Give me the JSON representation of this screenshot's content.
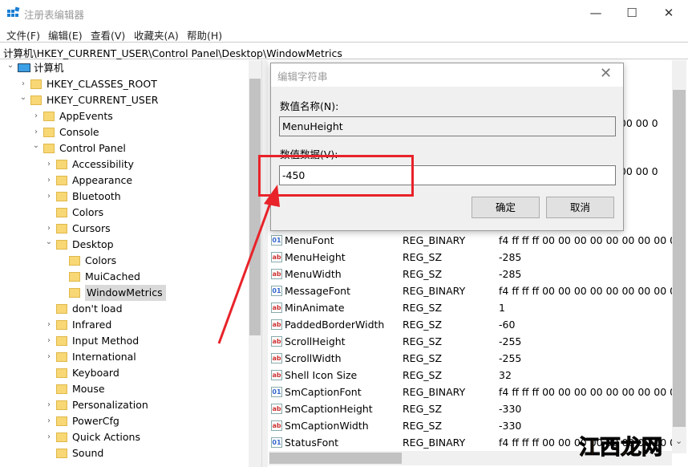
{
  "window": {
    "title": "注册表编辑器",
    "minimize": "—",
    "maximize": "☐",
    "close": "✕"
  },
  "menu": [
    "文件(F)",
    "编辑(E)",
    "查看(V)",
    "收藏夹(A)",
    "帮助(H)"
  ],
  "address": "计算机\\HKEY_CURRENT_USER\\Control Panel\\Desktop\\WindowMetrics",
  "tree": [
    {
      "label": "计算机",
      "depth": 0,
      "exp": "open",
      "icon": "computer"
    },
    {
      "label": "HKEY_CLASSES_ROOT",
      "depth": 1,
      "exp": "closed"
    },
    {
      "label": "HKEY_CURRENT_USER",
      "depth": 1,
      "exp": "open"
    },
    {
      "label": "AppEvents",
      "depth": 2,
      "exp": "closed"
    },
    {
      "label": "Console",
      "depth": 2,
      "exp": "closed"
    },
    {
      "label": "Control Panel",
      "depth": 2,
      "exp": "open"
    },
    {
      "label": "Accessibility",
      "depth": 3,
      "exp": "closed"
    },
    {
      "label": "Appearance",
      "depth": 3,
      "exp": "closed"
    },
    {
      "label": "Bluetooth",
      "depth": 3,
      "exp": "closed"
    },
    {
      "label": "Colors",
      "depth": 3,
      "exp": "none"
    },
    {
      "label": "Cursors",
      "depth": 3,
      "exp": "closed"
    },
    {
      "label": "Desktop",
      "depth": 3,
      "exp": "open"
    },
    {
      "label": "Colors",
      "depth": 4,
      "exp": "none"
    },
    {
      "label": "MuiCached",
      "depth": 4,
      "exp": "none"
    },
    {
      "label": "WindowMetrics",
      "depth": 4,
      "exp": "none",
      "selected": true
    },
    {
      "label": "don't load",
      "depth": 3,
      "exp": "none"
    },
    {
      "label": "Infrared",
      "depth": 3,
      "exp": "closed"
    },
    {
      "label": "Input Method",
      "depth": 3,
      "exp": "closed"
    },
    {
      "label": "International",
      "depth": 3,
      "exp": "closed"
    },
    {
      "label": "Keyboard",
      "depth": 3,
      "exp": "none"
    },
    {
      "label": "Mouse",
      "depth": 3,
      "exp": "none"
    },
    {
      "label": "Personalization",
      "depth": 3,
      "exp": "closed"
    },
    {
      "label": "PowerCfg",
      "depth": 3,
      "exp": "closed"
    },
    {
      "label": "Quick Actions",
      "depth": 3,
      "exp": "closed"
    },
    {
      "label": "Sound",
      "depth": 3,
      "exp": "none"
    }
  ],
  "values_partial": [
    "00 00 00 0",
    "00 00 00 0"
  ],
  "values": [
    {
      "name": "MenuFont",
      "type": "REG_BINARY",
      "data": "f4 ff ff ff 00 00 00 00 00 00 00 00 00 00 0"
    },
    {
      "name": "MenuHeight",
      "type": "REG_SZ",
      "data": "-285"
    },
    {
      "name": "MenuWidth",
      "type": "REG_SZ",
      "data": "-285"
    },
    {
      "name": "MessageFont",
      "type": "REG_BINARY",
      "data": "f4 ff ff ff 00 00 00 00 00 00 00 00 00 00 0"
    },
    {
      "name": "MinAnimate",
      "type": "REG_SZ",
      "data": "1"
    },
    {
      "name": "PaddedBorderWidth",
      "type": "REG_SZ",
      "data": "-60"
    },
    {
      "name": "ScrollHeight",
      "type": "REG_SZ",
      "data": "-255"
    },
    {
      "name": "ScrollWidth",
      "type": "REG_SZ",
      "data": "-255"
    },
    {
      "name": "Shell Icon Size",
      "type": "REG_SZ",
      "data": "32"
    },
    {
      "name": "SmCaptionFont",
      "type": "REG_BINARY",
      "data": "f4 ff ff ff 00 00 00 00 00 00 00 00 00 00 0"
    },
    {
      "name": "SmCaptionHeight",
      "type": "REG_SZ",
      "data": "-330"
    },
    {
      "name": "SmCaptionWidth",
      "type": "REG_SZ",
      "data": "-330"
    },
    {
      "name": "StatusFont",
      "type": "REG_BINARY",
      "data": "f4 ff ff ff 00 00 00 00 00 00 00 00 00 00 0"
    }
  ],
  "dialog": {
    "title": "编辑字符串",
    "name_label": "数值名称(N):",
    "name_value": "MenuHeight",
    "data_label": "数值数据(V):",
    "data_value": "-450",
    "ok": "确定",
    "cancel": "取消",
    "close": "✕"
  },
  "annotation": {
    "color": "#e8232a"
  },
  "watermark": "江西龙网"
}
